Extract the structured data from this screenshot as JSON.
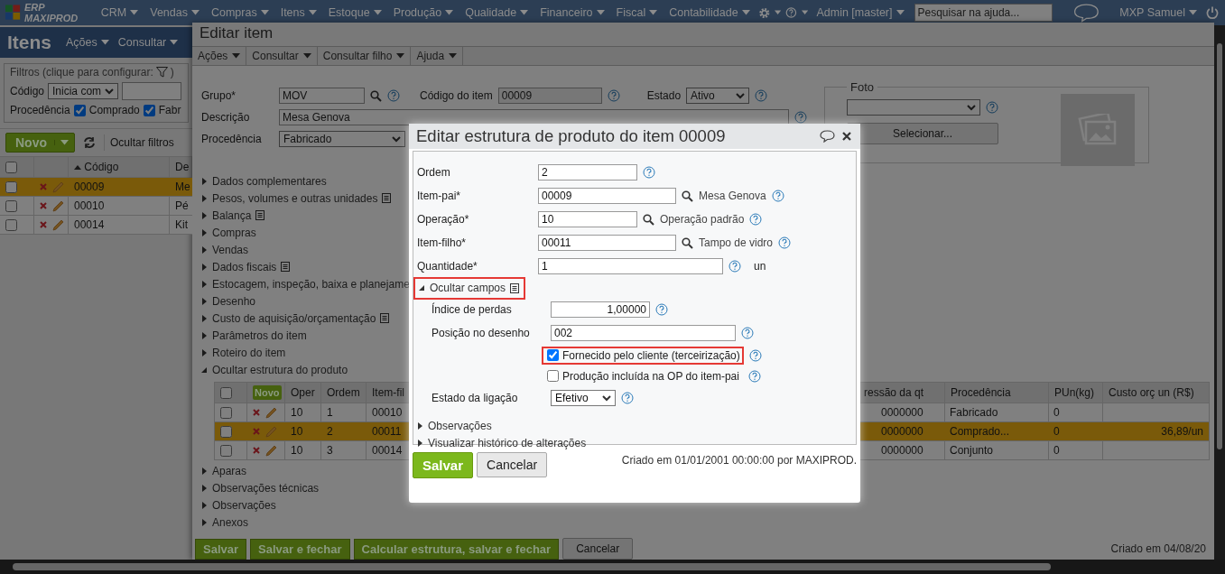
{
  "topbar": {
    "logo_text": "ERP MAXIPROD",
    "menus": [
      "CRM",
      "Vendas",
      "Compras",
      "Itens",
      "Estoque",
      "Produção",
      "Qualidade",
      "Financeiro",
      "Fiscal",
      "Contabilidade"
    ],
    "admin": "Admin [master]",
    "search": {
      "placeholder": "Pesquisar na ajuda..."
    },
    "user": "MXP Samuel"
  },
  "items_panel": {
    "title": "Itens",
    "menus": [
      "Ações",
      "Consultar"
    ],
    "filters": {
      "legend": "Filtros (clique para configurar:",
      "legend_end": ")",
      "code_label": "Código",
      "code_mode": "Inicia com",
      "origin_label": "Procedência",
      "options": [
        {
          "label": "Comprado",
          "checked": true
        },
        {
          "label": "Fabr",
          "checked": true
        }
      ]
    },
    "new_button": "Novo",
    "hide_filters": "Ocultar filtros",
    "select_all": false,
    "columns": [
      {
        "label": "Código",
        "sorted": true
      },
      {
        "label": "De",
        "sorted": false
      }
    ],
    "rows": [
      {
        "code": "00009",
        "desc": "Me",
        "selected": true,
        "checked": false
      },
      {
        "code": "00010",
        "desc": "Pé",
        "selected": false,
        "checked": false
      },
      {
        "code": "00014",
        "desc": "Kit",
        "selected": false,
        "checked": false
      }
    ]
  },
  "edit_item": {
    "title": "Editar item",
    "menus": [
      "Ações",
      "Consultar",
      "Consultar filho",
      "Ajuda"
    ],
    "group": {
      "label": "Grupo*",
      "value": "MOV"
    },
    "code": {
      "label": "Código do item",
      "value": "00009"
    },
    "status": {
      "label": "Estado",
      "value": "Ativo"
    },
    "description": {
      "label": "Descrição",
      "value": "Mesa Genova"
    },
    "origin": {
      "label": "Procedência",
      "value": "Fabricado"
    },
    "photo": {
      "legend": "Foto",
      "button": "Selecionar..."
    },
    "sections": [
      {
        "label": "Dados complementares",
        "note": false,
        "expanded": false
      },
      {
        "label": "Pesos, volumes e outras unidades",
        "note": true,
        "expanded": false
      },
      {
        "label": "Balança",
        "note": true,
        "expanded": false
      },
      {
        "label": "Compras",
        "note": false,
        "expanded": false
      },
      {
        "label": "Vendas",
        "note": false,
        "expanded": false
      },
      {
        "label": "Dados fiscais",
        "note": true,
        "expanded": false
      },
      {
        "label": "Estocagem, inspeção, baixa e planejame",
        "note": false,
        "expanded": false
      },
      {
        "label": "Desenho",
        "note": false,
        "expanded": false
      },
      {
        "label": "Custo de aquisição/orçamentação",
        "note": true,
        "expanded": false
      },
      {
        "label": "Parâmetros do item",
        "note": false,
        "expanded": false
      },
      {
        "label": "Roteiro do item",
        "note": false,
        "expanded": false
      },
      {
        "label": "Ocultar estrutura do produto",
        "note": false,
        "expanded": true
      },
      {
        "label": "Aparas",
        "note": false,
        "expanded": false
      },
      {
        "label": "Observações técnicas",
        "note": false,
        "expanded": false
      },
      {
        "label": "Observações",
        "note": false,
        "expanded": false
      },
      {
        "label": "Anexos",
        "note": false,
        "expanded": false
      }
    ],
    "structure": {
      "select_all": false,
      "new_button": "Novo",
      "columns": [
        "Oper",
        "Ordem",
        "Item-fil"
      ],
      "right_columns": [
        "ressão da qt",
        "Procedência",
        "PUn(kg)",
        "Custo orç un (R$)"
      ],
      "rows": [
        {
          "oper": "10",
          "order": "1",
          "child": "00010",
          "qty": "0000000",
          "origin": "Fabricado",
          "pun": "0",
          "cost": "",
          "selected": false,
          "checked": false
        },
        {
          "oper": "10",
          "order": "2",
          "child": "00011",
          "qty": "0000000",
          "origin": "Comprado...",
          "pun": "0",
          "cost": "36,89/un",
          "selected": true,
          "checked": false
        },
        {
          "oper": "10",
          "order": "3",
          "child": "00014",
          "qty": "0000000",
          "origin": "Conjunto",
          "pun": "0",
          "cost": "",
          "selected": false,
          "checked": false
        }
      ]
    },
    "buttons": [
      "Salvar",
      "Salvar e fechar",
      "Calcular estrutura, salvar e fechar",
      "Cancelar"
    ],
    "created": "Criado em 04/08/20"
  },
  "dialog": {
    "title": "Editar estrutura de produto do item 00009",
    "fields": [
      {
        "label": "Ordem",
        "value": "2"
      },
      {
        "label": "Item-pai*",
        "value": "00009",
        "lookup": "Mesa Genova"
      },
      {
        "label": "Operação*",
        "value": "10",
        "lookup": "Operação padrão"
      },
      {
        "label": "Item-filho*",
        "value": "00011",
        "lookup": "Tampo de vidro"
      },
      {
        "label": "Quantidade*",
        "value": "1",
        "unit": "un"
      }
    ],
    "toggle": {
      "label": "Ocultar campos",
      "expanded": true,
      "highlighted": true
    },
    "sub_fields": [
      {
        "label": "Índice de perdas",
        "value": "1,00000"
      },
      {
        "label": "Posição no desenho",
        "value": "002"
      }
    ],
    "checkboxes": [
      {
        "label": "Fornecido pelo cliente (terceirização)",
        "checked": true,
        "highlighted": true
      },
      {
        "label": "Produção incluída na OP do item-pai",
        "checked": false,
        "highlighted": false
      }
    ],
    "link_status": {
      "label": "Estado da ligação",
      "value": "Efetivo"
    },
    "sections": [
      "Observações",
      "Visualizar histórico de alterações"
    ],
    "buttons": [
      {
        "label": "Salvar",
        "kind": "primary"
      },
      {
        "label": "Cancelar",
        "kind": "secondary"
      }
    ],
    "created": "Criado em 01/01/2001 00:00:00 por MAXIPROD."
  }
}
